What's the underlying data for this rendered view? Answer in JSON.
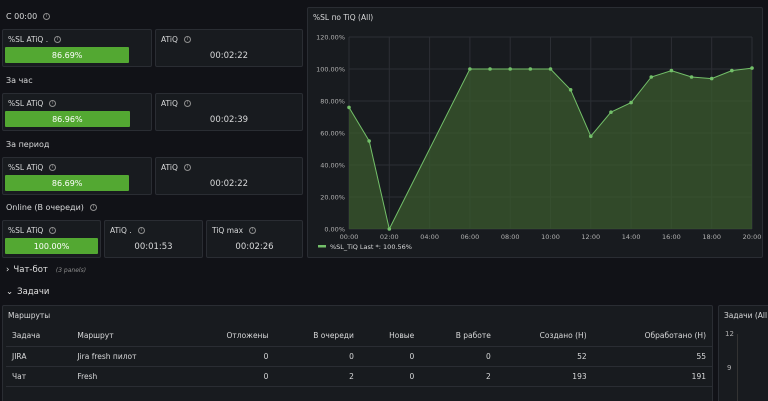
{
  "sections": {
    "since_midnight": "С 00:00",
    "per_hour": "За час",
    "per_period": "За период",
    "online": "Online (В очереди)"
  },
  "row1": {
    "sl_title": "%SL ATiQ .",
    "sl_value": "86.69%",
    "sl_fraction": 0.8669,
    "atiq_title": "ATiQ",
    "atiq_value": "00:02:22"
  },
  "row2": {
    "sl_title": "%SL ATiQ",
    "sl_value": "86.96%",
    "sl_fraction": 0.8696,
    "atiq_title": "ATiQ",
    "atiq_value": "00:02:39"
  },
  "row3": {
    "sl_title": "%SL ATiQ",
    "sl_value": "86.69%",
    "sl_fraction": 0.8669,
    "atiq_title": "ATiQ",
    "atiq_value": "00:02:22"
  },
  "row4": {
    "sl_title": "%SL ATiQ",
    "sl_value": "100.00%",
    "sl_fraction": 1.0,
    "atiq_title": "ATiQ .",
    "atiq_value": "00:01:53",
    "tiq_title": "TiQ max",
    "tiq_value": "00:02:26"
  },
  "chart_panel": {
    "title": "%SL по TiQ (All)",
    "legend": "%SL_TiQ  Last *: 100.56%"
  },
  "chart_data": {
    "type": "area",
    "x": [
      "00:00",
      "01:00",
      "02:00",
      "03:00",
      "04:00",
      "05:00",
      "06:00",
      "07:00",
      "08:00",
      "09:00",
      "10:00",
      "11:00",
      "12:00",
      "13:00",
      "14:00",
      "15:00",
      "16:00",
      "17:00",
      "18:00",
      "19:00",
      "20:00"
    ],
    "x_positions": [
      0,
      1,
      2,
      6,
      7,
      8,
      9,
      10,
      11,
      12,
      13,
      14,
      15,
      16,
      17,
      18,
      19,
      20
    ],
    "values": [
      76,
      55,
      0,
      100,
      100,
      100,
      100,
      100,
      87,
      58,
      73,
      79,
      95,
      99,
      95,
      94,
      99,
      100.56
    ],
    "tick_labels_x": [
      "00:00",
      "02:00",
      "04:00",
      "06:00",
      "08:00",
      "10:00",
      "12:00",
      "14:00",
      "16:00",
      "18:00",
      "20:00"
    ],
    "tick_labels_y": [
      "0.00%",
      "20.00%",
      "40.00%",
      "60.00%",
      "80.00%",
      "100.00%",
      "120.00%"
    ],
    "ylim": [
      0,
      120
    ],
    "series": [
      {
        "name": "%SL_TiQ"
      }
    ],
    "colors": {
      "line": "#73bf69",
      "fill": "#3a5a2e"
    }
  },
  "chatbot": {
    "label": "Чат-бот",
    "sub": "(3 panels)"
  },
  "tasks": {
    "label": "Задачи"
  },
  "routes": {
    "title": "Маршруты",
    "columns": [
      "Задача",
      "Маршрут",
      "Отложены",
      "В очереди",
      "Новые",
      "В работе",
      "Создано (Н)",
      "Обработано (Н)"
    ],
    "rows": [
      [
        "JIRA",
        "Jira fresh пилот",
        "0",
        "0",
        "0",
        "0",
        "52",
        "55"
      ],
      [
        "Чат",
        "Fresh",
        "0",
        "2",
        "0",
        "2",
        "193",
        "191"
      ]
    ]
  },
  "tasks_panel": {
    "title": "Задачи (All",
    "y_ticks": [
      "12",
      "9"
    ]
  }
}
